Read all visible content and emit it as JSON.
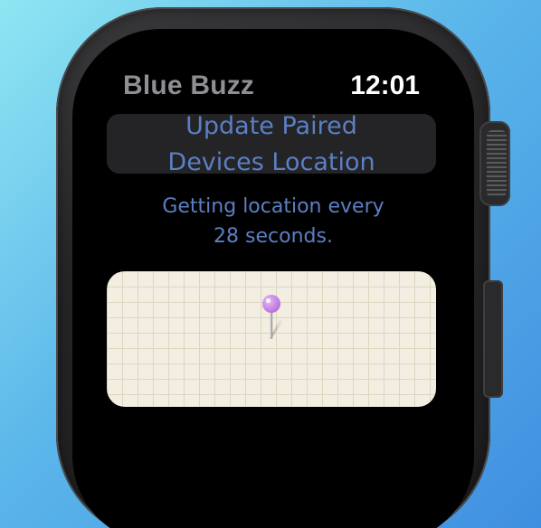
{
  "app": {
    "title": "Blue Buzz",
    "time": "12:01"
  },
  "action_button": {
    "label_line1": "Update Paired",
    "label_line2": "Devices Location"
  },
  "status": {
    "line1": "Getting location every",
    "line2": "28 seconds."
  },
  "map": {
    "pin_icon": "map-pin-icon",
    "pin_color": "#c07ee0"
  },
  "colors": {
    "accent": "#5b7fc4",
    "title_gray": "#8e8e93",
    "map_background": "#f3eee2"
  }
}
